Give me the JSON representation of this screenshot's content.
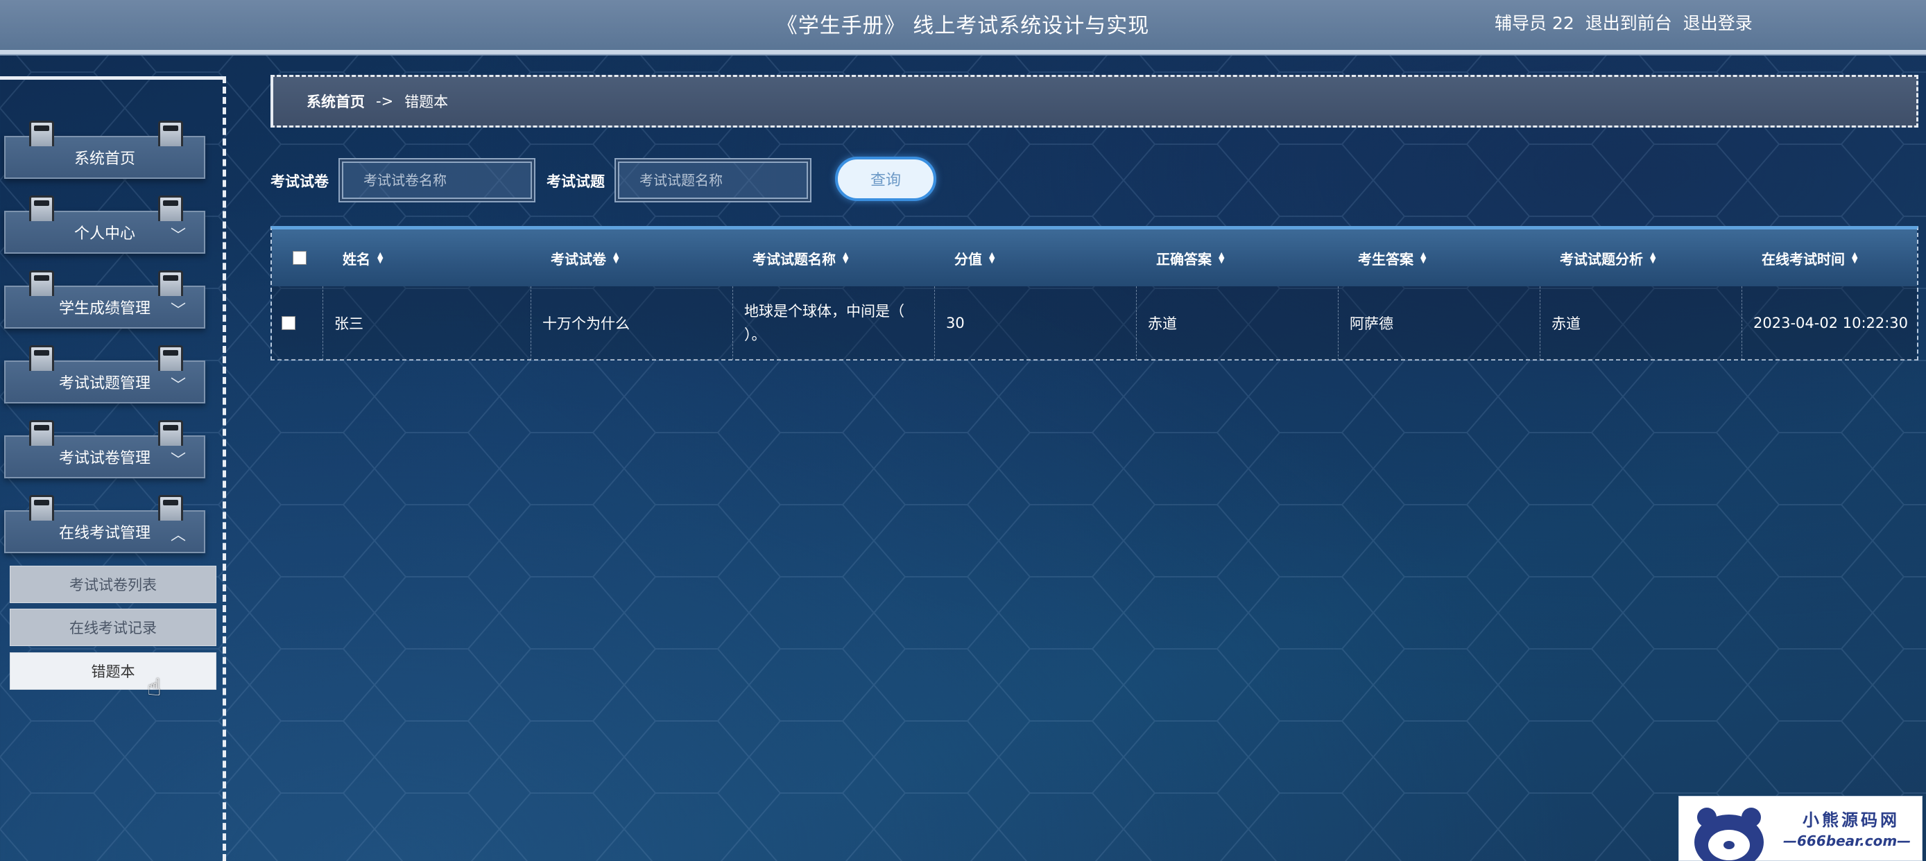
{
  "header": {
    "title": "《学生手册》 线上考试系统设计与实现",
    "user": "辅导员 22",
    "to_front": "退出到前台",
    "logout": "退出登录"
  },
  "sidebar": {
    "items": [
      {
        "label": "系统首页",
        "chevron": ""
      },
      {
        "label": "个人中心",
        "chevron": "﹀"
      },
      {
        "label": "学生成绩管理",
        "chevron": "﹀"
      },
      {
        "label": "考试试题管理",
        "chevron": "﹀"
      },
      {
        "label": "考试试卷管理",
        "chevron": "﹀"
      },
      {
        "label": "在线考试管理",
        "chevron": "︿"
      }
    ],
    "subitems": [
      {
        "label": "考试试卷列表"
      },
      {
        "label": "在线考试记录"
      },
      {
        "label": "错题本"
      }
    ]
  },
  "breadcrumb": {
    "home": "系统首页",
    "sep": "->",
    "current": "错题本"
  },
  "search": {
    "paper_label": "考试试卷",
    "paper_placeholder": "考试试卷名称",
    "question_label": "考试试题",
    "question_placeholder": "考试试题名称",
    "query_button": "查询"
  },
  "table": {
    "columns": [
      "姓名",
      "考试试卷",
      "考试试题名称",
      "分值",
      "正确答案",
      "考生答案",
      "考试试题分析",
      "在线考试时间"
    ],
    "rows": [
      {
        "name": "张三",
        "paper": "十万个为什么",
        "question_line1": "地球是个球体，中间是（",
        "question_line2": "）。",
        "score": "30",
        "correct": "赤道",
        "answer": "阿萨德",
        "analysis": "赤道",
        "time": "2023-04-02 10:22:30"
      }
    ]
  },
  "watermark": {
    "brand": "小熊源码网",
    "site": "—666bear.com—"
  },
  "colors": {
    "header": "#6f87a5",
    "accent": "#3a8fe0",
    "table_header": "#2d5580"
  }
}
